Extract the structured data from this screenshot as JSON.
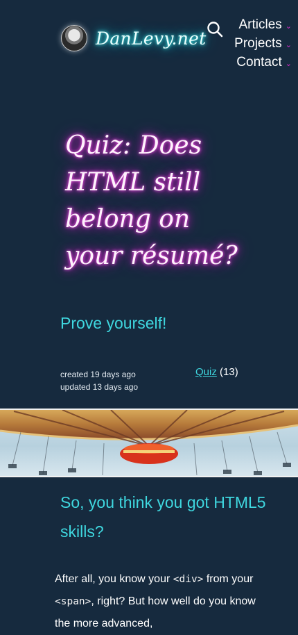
{
  "brand": {
    "name": "DanLevy.net"
  },
  "nav": {
    "items": [
      {
        "label": "Articles"
      },
      {
        "label": "Projects"
      },
      {
        "label": "Contact"
      }
    ]
  },
  "article": {
    "title": "Quiz: Does HTML still belong on your résumé?",
    "subtitle": "Prove yourself!",
    "created": "created 19 days ago",
    "updated": "updated 13 days ago",
    "tag": {
      "label": "Quiz",
      "count": "(13)"
    },
    "section_heading": "So, you think you got HTML5 skills?",
    "body": {
      "p1_start": "After all, you know your ",
      "code1": "<div>",
      "p1_mid": " from your ",
      "code2": "<span>",
      "p1_end": ", right? But how well do you know the more advanced,"
    }
  },
  "colors": {
    "background": "#162a3e",
    "accent_cyan": "#3fd7df",
    "accent_magenta": "#e02bd0"
  },
  "icons": {
    "search": "search-icon",
    "dropdown": "chevron-down-icon"
  }
}
